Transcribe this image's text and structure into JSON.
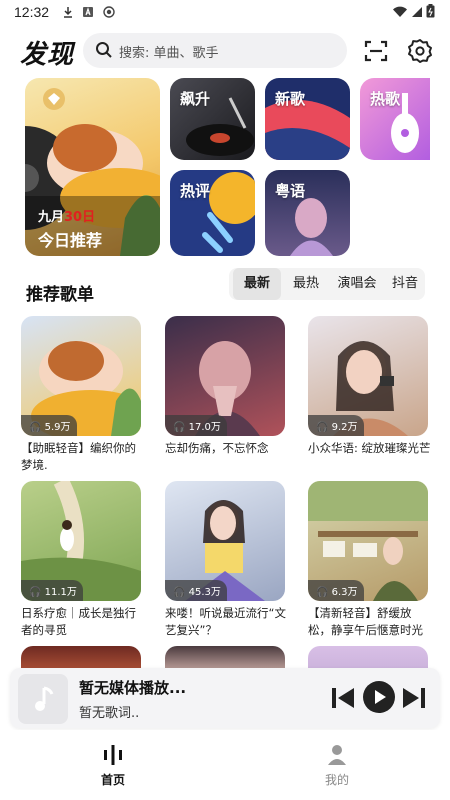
{
  "status_bar": {
    "time": "12:32"
  },
  "header": {
    "title": "发现",
    "search_placeholder": "搜索: 单曲、歌手"
  },
  "banner": {
    "month": "九月",
    "day": "30日",
    "label": "今日推荐"
  },
  "tiles": [
    {
      "label": "飙升"
    },
    {
      "label": "新歌"
    },
    {
      "label": "热歌"
    },
    {
      "label": "热评"
    },
    {
      "label": "粤语"
    }
  ],
  "section": {
    "title": "推荐歌单",
    "tabs": [
      "最新",
      "最热",
      "演唱会",
      "抖音"
    ],
    "active_tab": "最新"
  },
  "playlists": [
    {
      "plays": "5.9万",
      "title": "【助眠轻音】编织你的梦境."
    },
    {
      "plays": "17.0万",
      "title": "忘却伤痛，不忘怀念"
    },
    {
      "plays": "9.2万",
      "title": "小众华语: 绽放璀璨光芒"
    },
    {
      "plays": "11.1万",
      "title": "日系疗愈｜成长是独行者的寻觅"
    },
    {
      "plays": "45.3万",
      "title": "来喽！听说最近流行“文艺复兴”？"
    },
    {
      "plays": "6.3万",
      "title": "【清新轻音】舒缓放松，静享午后惬意时光"
    }
  ],
  "player": {
    "title": "暂无媒体播放...",
    "subtitle": "暂无歌词.."
  },
  "nav": [
    {
      "label": "首页",
      "active": true
    },
    {
      "label": "我的",
      "active": false
    }
  ],
  "colors": {
    "accent": "#e02020",
    "text": "#111111",
    "muted": "#888888"
  }
}
